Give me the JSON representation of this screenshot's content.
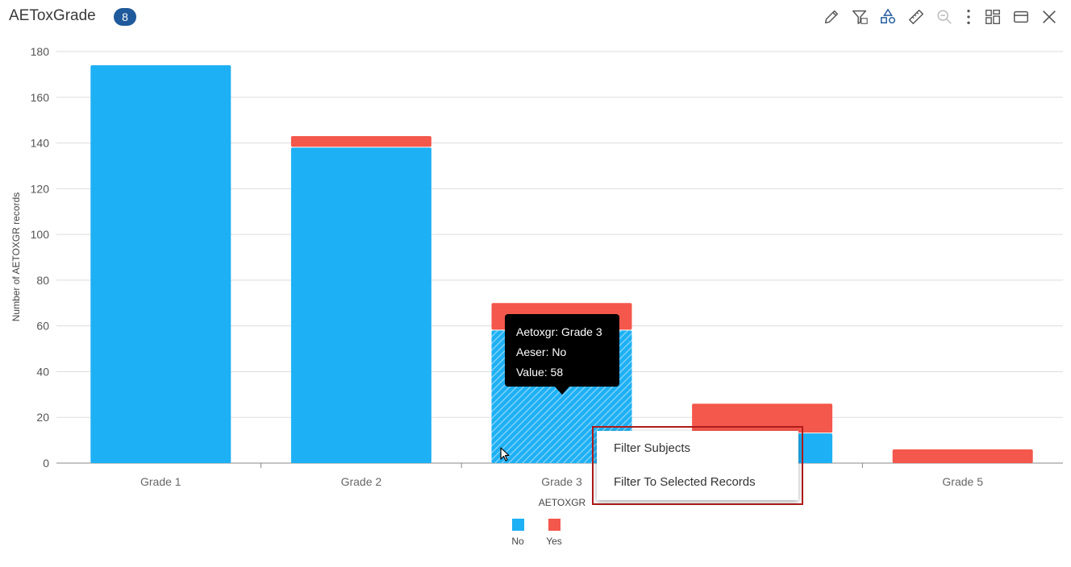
{
  "header": {
    "title": "AEToxGrade",
    "badge": "8"
  },
  "toolbar": {
    "icons": [
      "pencil-icon",
      "filter-data-icon",
      "shapes-icon",
      "ruler-icon",
      "zoom-out-icon",
      "more-vertical-icon",
      "layout-icon",
      "window-icon",
      "close-icon"
    ]
  },
  "colors": {
    "no": "#1eb0f4",
    "yes": "#f4574b",
    "highlight_border": "#b01a1a"
  },
  "chart_data": {
    "type": "bar",
    "stacked": true,
    "categories": [
      "Grade 1",
      "Grade 2",
      "Grade 3",
      "Grade 4",
      "Grade 5"
    ],
    "series": [
      {
        "name": "No",
        "values": [
          174,
          138,
          58,
          13,
          0
        ]
      },
      {
        "name": "Yes",
        "values": [
          0,
          5,
          12,
          13,
          6
        ]
      }
    ],
    "xlabel": "AETOXGR",
    "ylabel": "Number of AETOXGR records",
    "ylim": [
      0,
      180
    ],
    "yticks": [
      0,
      20,
      40,
      60,
      80,
      100,
      120,
      140,
      160,
      180
    ],
    "grid": true,
    "legend": "bottom-center",
    "selected": {
      "category": "Grade 3",
      "series": "No"
    }
  },
  "tooltip": {
    "line1": "Aetoxgr: Grade 3",
    "line2": "Aeser: No",
    "line3": "Value: 58"
  },
  "context_menu": {
    "items": [
      "Filter Subjects",
      "Filter To Selected Records"
    ]
  },
  "legend": {
    "no_label": "No",
    "yes_label": "Yes"
  }
}
